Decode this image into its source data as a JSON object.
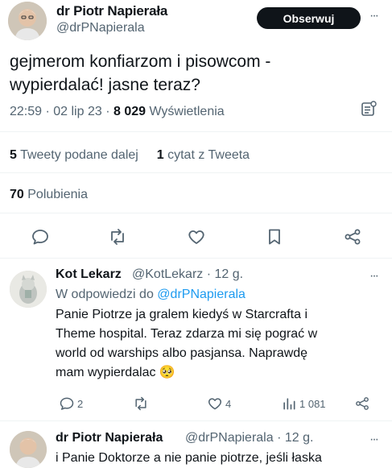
{
  "tweet": {
    "author_name": "dr Piotr Napierała",
    "author_handle": "@drPNapierala",
    "follow_label": "Obserwuj",
    "text_line1": "gejmerom konfiarzom i pisowcom -",
    "text_line2": "wypierdalać!  jasne teraz?",
    "time": "22:59 · 02 lip 23 · ",
    "views_count": "8 029",
    "views_label": " Wyświetlenia",
    "retweets_count": "5",
    "retweets_label": " Tweety podane dalej",
    "quotes_count": "1",
    "quotes_label": " cytat z Tweeta",
    "likes_count": "70",
    "likes_label": " Polubienia"
  },
  "replies": [
    {
      "name": "Kot Lekarz",
      "handle_time": "@KotLekarz · 12 g.",
      "replying_prefix": "W odpowiedzi do ",
      "replying_handle": "@drPNapierala",
      "line1": "Panie Piotrze ja gralem kiedyś w Starcrafta i",
      "line2": "Theme hospital. Teraz zdarza mi się pograć w",
      "line3": "world od warships albo pasjansa. Naprawdę",
      "line4": "mam wypierdalac 🥺",
      "reply_count": "2",
      "retweet_count": "",
      "like_count": "4",
      "views_count": "1 081"
    },
    {
      "name": "dr Piotr Napierała",
      "handle_time": "@drPNapierala · 12 g.",
      "line1": "i Panie Doktorze a nie panie piotrze, jeśli łaska"
    }
  ],
  "icons": {
    "more": "more-icon",
    "analytics": "analytics-icon",
    "reply": "reply-icon",
    "retweet": "retweet-icon",
    "like": "like-icon",
    "bookmark": "bookmark-icon",
    "share": "share-icon",
    "views": "views-icon"
  },
  "colors": {
    "text": "#0f1419",
    "secondary": "#536471",
    "link": "#1d9bf0",
    "follow_bg": "#0f1419",
    "divider": "#eff3f4"
  }
}
